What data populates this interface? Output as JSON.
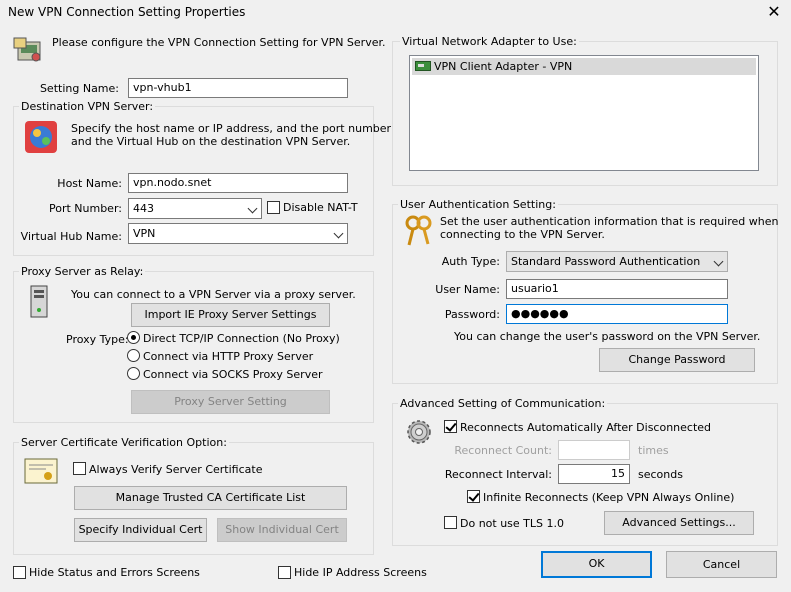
{
  "window": {
    "title": "New VPN Connection Setting Properties",
    "close": "✕"
  },
  "intro": "Please configure the VPN Connection Setting for VPN Server.",
  "setting_name": {
    "label": "Setting Name:",
    "value": "vpn-vhub1"
  },
  "dest": {
    "group": "Destination VPN Server:",
    "desc": [
      "Specify the host name or IP address, and the port number",
      "and the Virtual Hub on the destination VPN Server."
    ],
    "host_label": "Host Name:",
    "host_value": "vpn.nodo.snet",
    "port_label": "Port Number:",
    "port_value": "443",
    "nat_label": "Disable NAT-T",
    "hub_label": "Virtual Hub Name:",
    "hub_value": "VPN"
  },
  "proxy": {
    "group": "Proxy Server as Relay:",
    "desc": "You can connect to a VPN Server via a proxy server.",
    "import_btn": "Import IE Proxy Server Settings",
    "type_label": "Proxy Type:",
    "opt_direct": "Direct TCP/IP Connection (No Proxy)",
    "opt_http": "Connect via HTTP Proxy Server",
    "opt_socks": "Connect via SOCKS Proxy Server",
    "setting_btn": "Proxy Server Setting"
  },
  "cert": {
    "group": "Server Certificate Verification Option:",
    "always_label": "Always Verify Server Certificate",
    "manage_btn": "Manage Trusted CA Certificate List",
    "specify_btn": "Specify Individual Cert",
    "show_btn": "Show Individual Cert"
  },
  "bottom": {
    "hide_status": "Hide Status and Errors Screens",
    "hide_ip": "Hide IP Address Screens"
  },
  "adapter": {
    "group": "Virtual Network Adapter to Use:",
    "item": "VPN Client Adapter - VPN"
  },
  "auth": {
    "group": "User Authentication Setting:",
    "desc": [
      "Set the user authentication information that is required when",
      "connecting to the VPN Server."
    ],
    "type_label": "Auth Type:",
    "type_value": "Standard Password Authentication",
    "user_label": "User Name:",
    "user_value": "usuario1",
    "pass_label": "Password:",
    "pass_value": "●●●●●●",
    "hint": "You can change the user's password on the VPN Server.",
    "change_btn": "Change Password"
  },
  "adv": {
    "group": "Advanced Setting of Communication:",
    "reconnect_label": "Reconnects Automatically After Disconnected",
    "count_label": "Reconnect Count:",
    "count_value": "",
    "count_unit": "times",
    "interval_label": "Reconnect Interval:",
    "interval_value": "15",
    "interval_unit": "seconds",
    "infinite_label": "Infinite Reconnects (Keep VPN Always Online)",
    "tls_label": "Do not use TLS 1.0",
    "adv_btn": "Advanced Settings..."
  },
  "dialog": {
    "ok": "OK",
    "cancel": "Cancel"
  }
}
